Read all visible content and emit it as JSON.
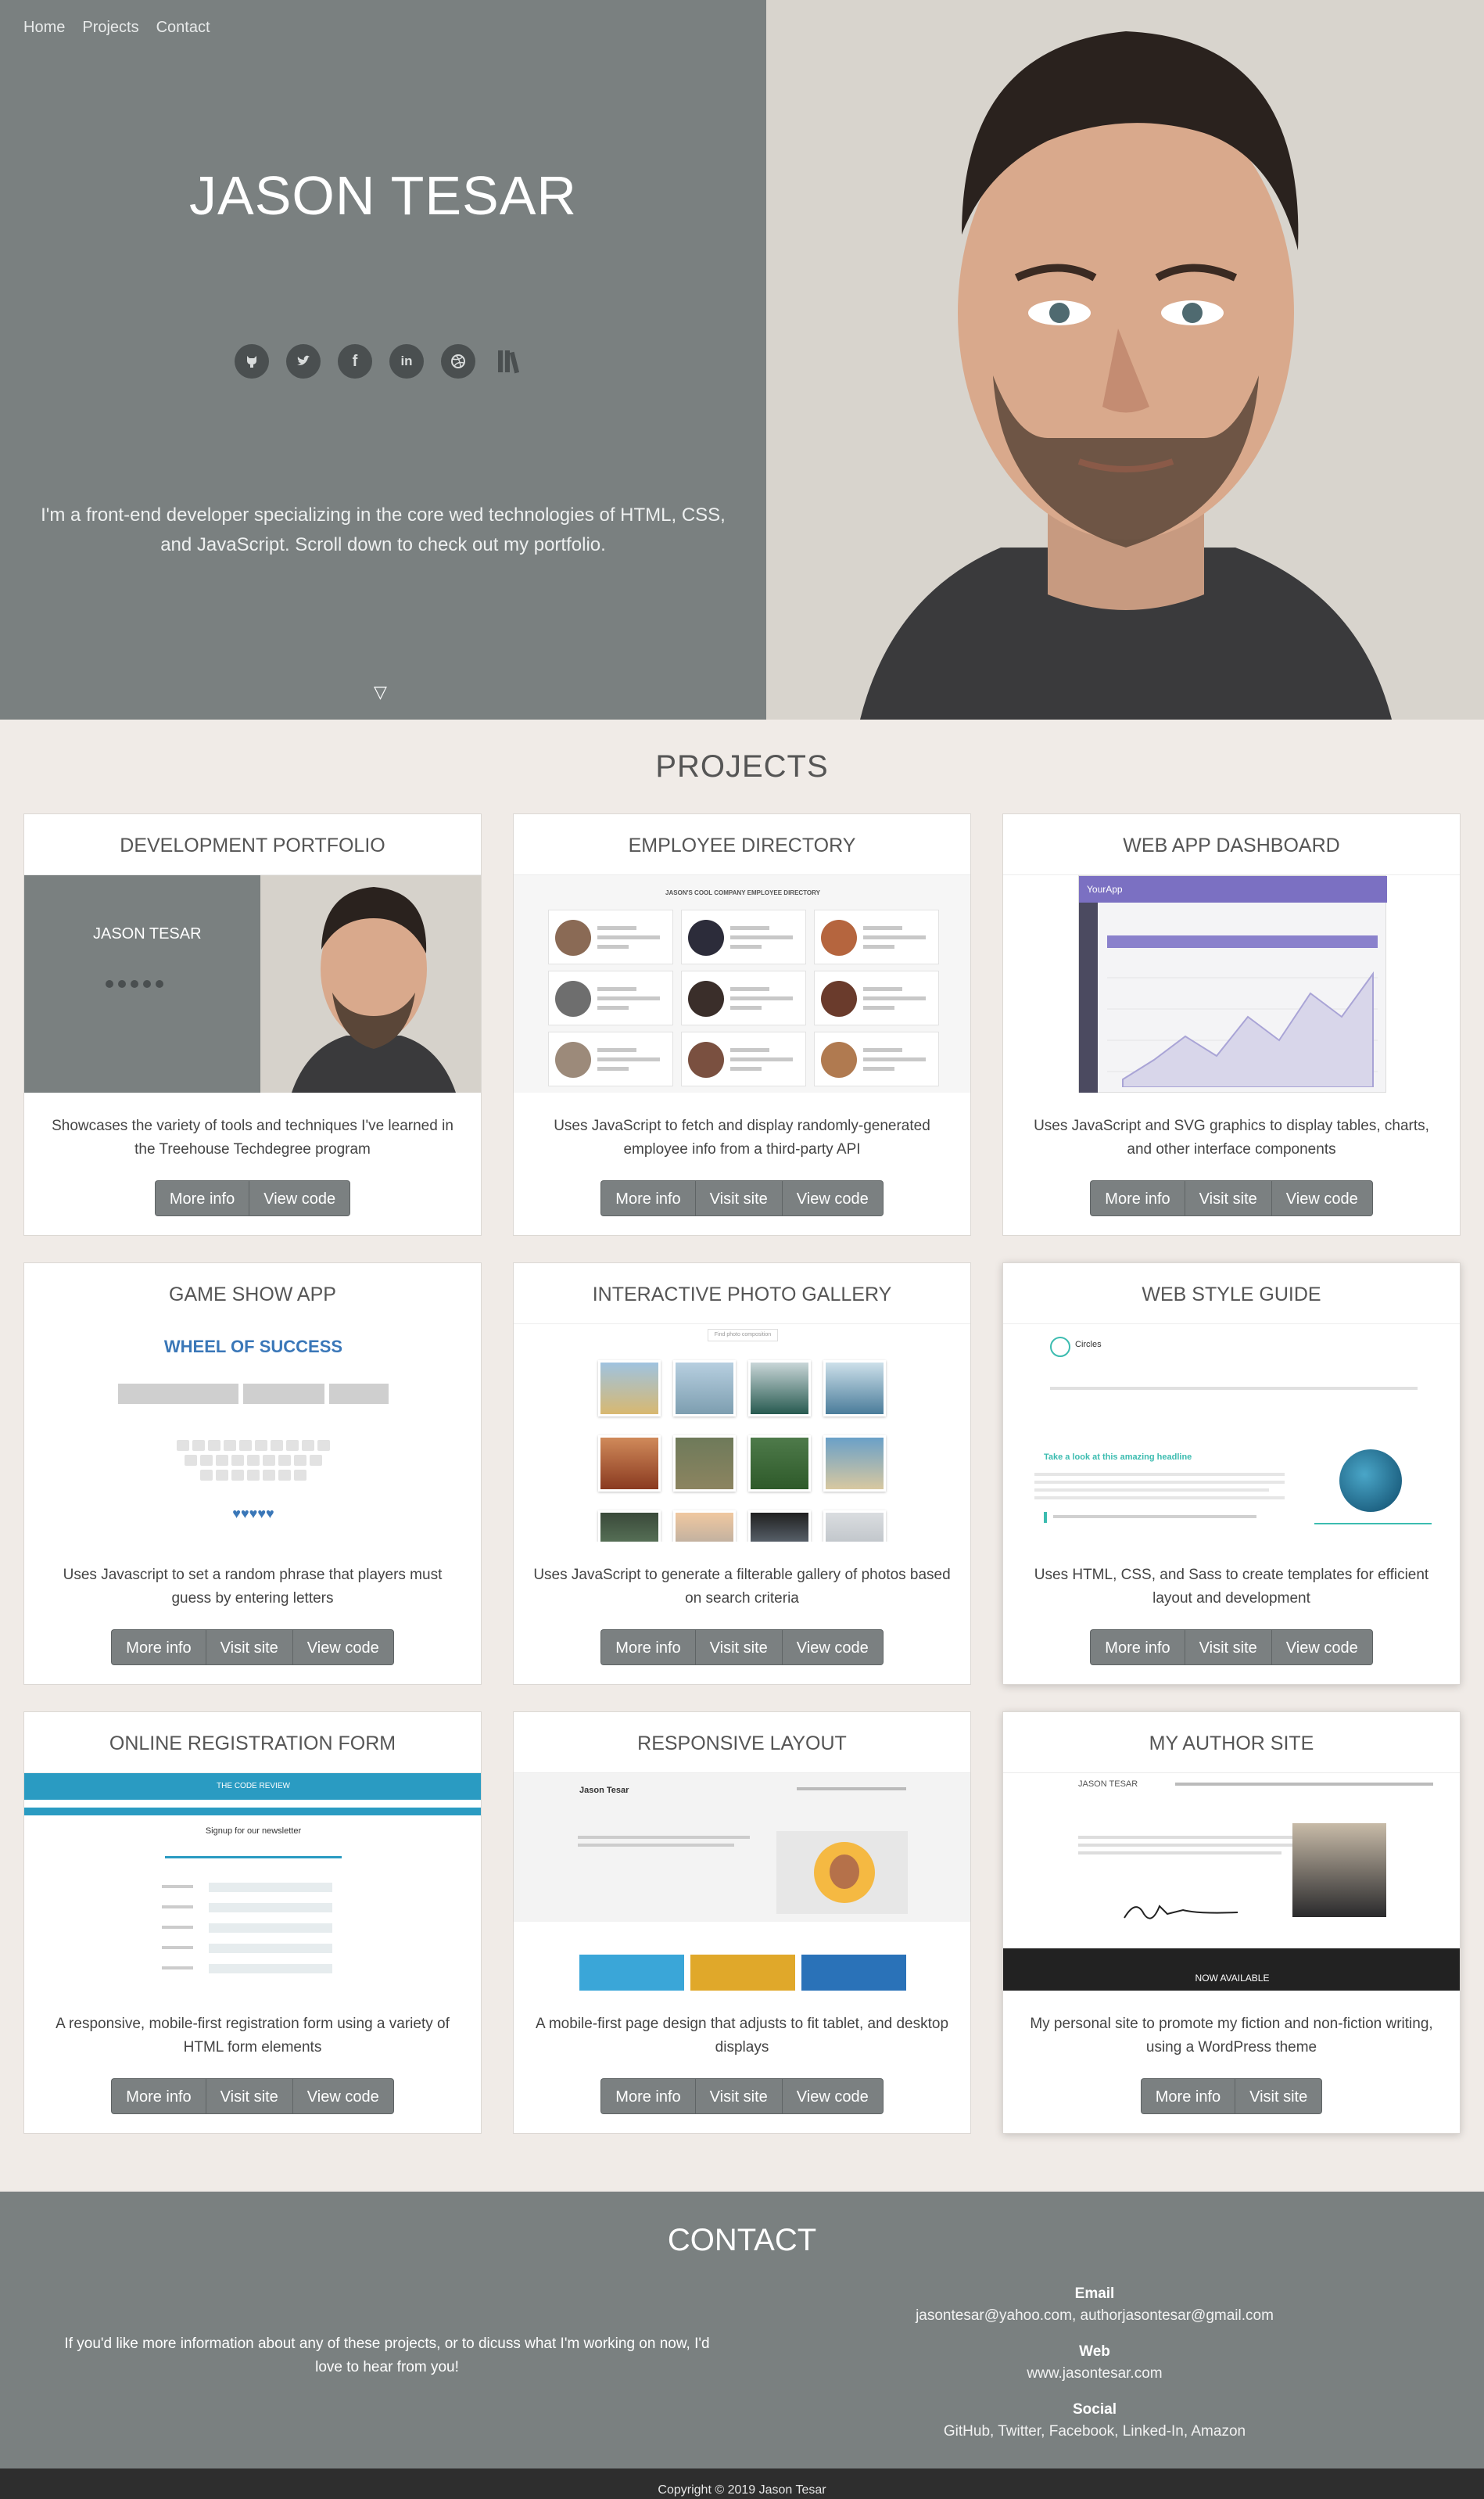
{
  "nav": [
    "Home",
    "Projects",
    "Contact"
  ],
  "hero": {
    "name": "JASON TESAR",
    "intro": "I'm a front-end developer specializing in the core wed technologies of HTML, CSS, and JavaScript. Scroll down to check out my portfolio.",
    "scroll_icon": "▽",
    "social_icons": [
      "github-icon",
      "twitter-icon",
      "facebook-icon",
      "linkedin-icon",
      "dribbble-icon",
      "books-icon"
    ]
  },
  "projects": {
    "title": "PROJECTS",
    "items": [
      {
        "title": "DEVELOPMENT PORTFOLIO",
        "desc": "Showcases the variety of tools and techniques I've learned in the Treehouse Techdegree program",
        "buttons": [
          "More info",
          "View code"
        ]
      },
      {
        "title": "EMPLOYEE DIRECTORY",
        "desc": "Uses JavaScript to fetch and display randomly-generated employee info from a third-party API",
        "buttons": [
          "More info",
          "Visit site",
          "View code"
        ]
      },
      {
        "title": "WEB APP DASHBOARD",
        "desc": "Uses JavaScript and SVG graphics to display tables, charts, and other interface components",
        "buttons": [
          "More info",
          "Visit site",
          "View code"
        ]
      },
      {
        "title": "GAME SHOW APP",
        "desc": "Uses Javascript to set a random phrase that players must guess by entering letters",
        "buttons": [
          "More info",
          "Visit site",
          "View code"
        ]
      },
      {
        "title": "INTERACTIVE PHOTO GALLERY",
        "desc": "Uses JavaScript to generate a filterable gallery of photos based on search criteria",
        "buttons": [
          "More info",
          "Visit site",
          "View code"
        ]
      },
      {
        "title": "WEB STYLE GUIDE",
        "desc": "Uses HTML, CSS, and Sass to create templates for efficient layout and development",
        "buttons": [
          "More info",
          "Visit site",
          "View code"
        ]
      },
      {
        "title": "ONLINE REGISTRATION FORM",
        "desc": "A responsive, mobile-first registration form using a variety of HTML form elements",
        "buttons": [
          "More info",
          "Visit site",
          "View code"
        ]
      },
      {
        "title": "RESPONSIVE LAYOUT",
        "desc": "A mobile-first page design that adjusts to fit tablet, and desktop displays",
        "buttons": [
          "More info",
          "Visit site",
          "View code"
        ]
      },
      {
        "title": "MY AUTHOR SITE",
        "desc": "My personal site to promote my fiction and non-fiction writing, using a WordPress theme",
        "buttons": [
          "More info",
          "Visit site"
        ]
      }
    ]
  },
  "thumbs": {
    "portfolio_name": "JASON TESAR",
    "directory_heading": "JASON'S COOL COMPANY EMPLOYEE DIRECTORY",
    "dashboard_brand": "YourApp",
    "game_title": "WHEEL OF SUCCESS",
    "game_hearts": "♥♥♥♥♥",
    "gallery_search": "Find photo composition",
    "style_guide_brand": "Circles",
    "style_guide_heading": "Take a look at this amazing headline",
    "registration_banner": "THE CODE REVIEW",
    "registration_signup": "Signup for our newsletter",
    "layout_brand": "Jason Tesar",
    "author_site_name": "JASON TESAR",
    "author_banner": "NOW AVAILABLE"
  },
  "contact": {
    "title": "CONTACT",
    "text": "If you'd like more information about any of these projects, or to dicuss what I'm working on now, I'd love to hear from you!",
    "email_label": "Email",
    "email_value": "jasontesar@yahoo.com, authorjasontesar@gmail.com",
    "web_label": "Web",
    "web_value": "www.jasontesar.com",
    "social_label": "Social",
    "social_value": "GitHub, Twitter, Facebook, Linked-In, Amazon"
  },
  "footer": "Copyright © 2019 Jason Tesar"
}
